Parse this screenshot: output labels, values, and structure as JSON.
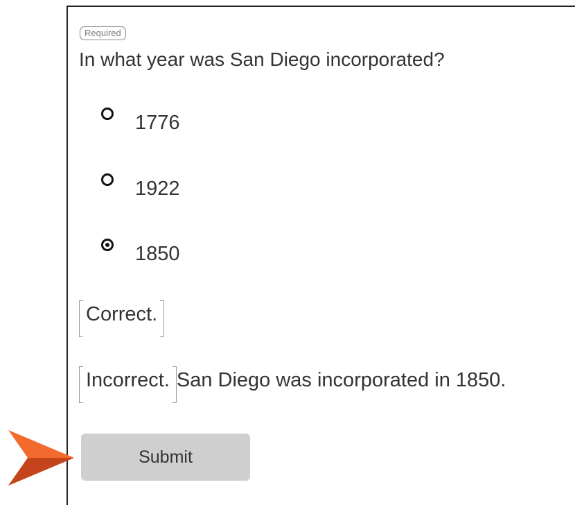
{
  "quiz": {
    "required_badge": "Required",
    "question": "In what year was San Diego incorporated?",
    "options": [
      {
        "label": "1776",
        "selected": false
      },
      {
        "label": "1922",
        "selected": false
      },
      {
        "label": "1850",
        "selected": true
      }
    ],
    "feedback_correct": {
      "label": "Correct."
    },
    "feedback_incorrect": {
      "label": "Incorrect.",
      "detail": "San Diego was incorporated in 1850."
    },
    "submit_label": "Submit"
  },
  "colors": {
    "text": "#333333",
    "button_background": "#cfcfcf",
    "arrow_orange": "#f26a2e",
    "arrow_dark": "#c4441c"
  },
  "icons": {
    "pointer": "arrow-pointer-icon"
  }
}
